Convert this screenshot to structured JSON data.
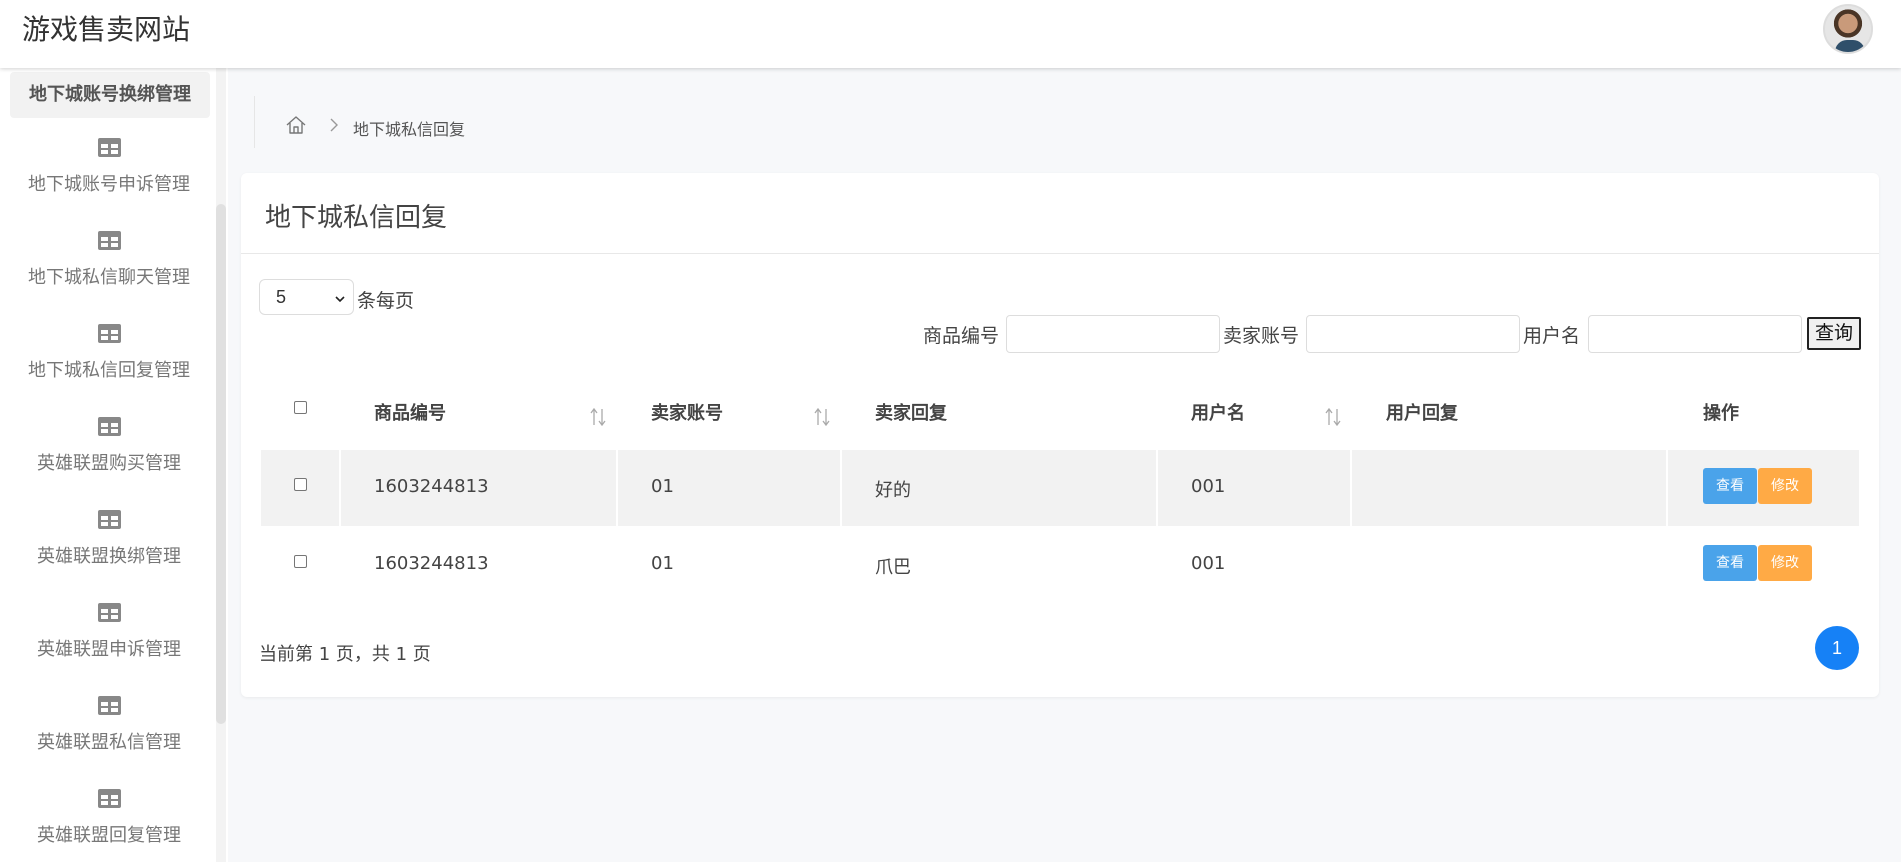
{
  "header": {
    "title": "游戏售卖网站"
  },
  "sidebar": {
    "active_item": "地下城账号换绑管理",
    "items": [
      {
        "label": "地下城账号申诉管理",
        "icon": "table-icon"
      },
      {
        "label": "地下城私信聊天管理",
        "icon": "table-icon"
      },
      {
        "label": "地下城私信回复管理",
        "icon": "table-icon"
      },
      {
        "label": "英雄联盟购买管理",
        "icon": "table-icon"
      },
      {
        "label": "英雄联盟换绑管理",
        "icon": "table-icon"
      },
      {
        "label": "英雄联盟申诉管理",
        "icon": "table-icon"
      },
      {
        "label": "英雄联盟私信管理",
        "icon": "table-icon"
      },
      {
        "label": "英雄联盟回复管理",
        "icon": "table-icon"
      }
    ]
  },
  "breadcrumb": {
    "home_icon": "home-icon",
    "current": "地下城私信回复"
  },
  "panel": {
    "title": "地下城私信回复",
    "page_size": "5",
    "page_size_label": "条每页",
    "search": {
      "fields": [
        {
          "label": "商品编号",
          "value": ""
        },
        {
          "label": "卖家账号",
          "value": ""
        },
        {
          "label": "用户名",
          "value": ""
        }
      ],
      "button": "查询"
    },
    "table": {
      "headers": [
        "商品编号",
        "卖家账号",
        "卖家回复",
        "用户名",
        "用户回复",
        "操作"
      ],
      "rows": [
        {
          "product_no": "1603244813",
          "seller_account": "01",
          "seller_reply": "好的",
          "username": "001",
          "user_reply": ""
        },
        {
          "product_no": "1603244813",
          "seller_account": "01",
          "seller_reply": "爪巴",
          "username": "001",
          "user_reply": ""
        }
      ],
      "actions": {
        "view": "查看",
        "edit": "修改"
      }
    },
    "pagination": {
      "info": "当前第 1 页，共 1 页",
      "current": "1"
    }
  },
  "colors": {
    "primary": "#1681f6",
    "view_button": "#4aa3ea",
    "edit_button": "#ffaa45"
  }
}
